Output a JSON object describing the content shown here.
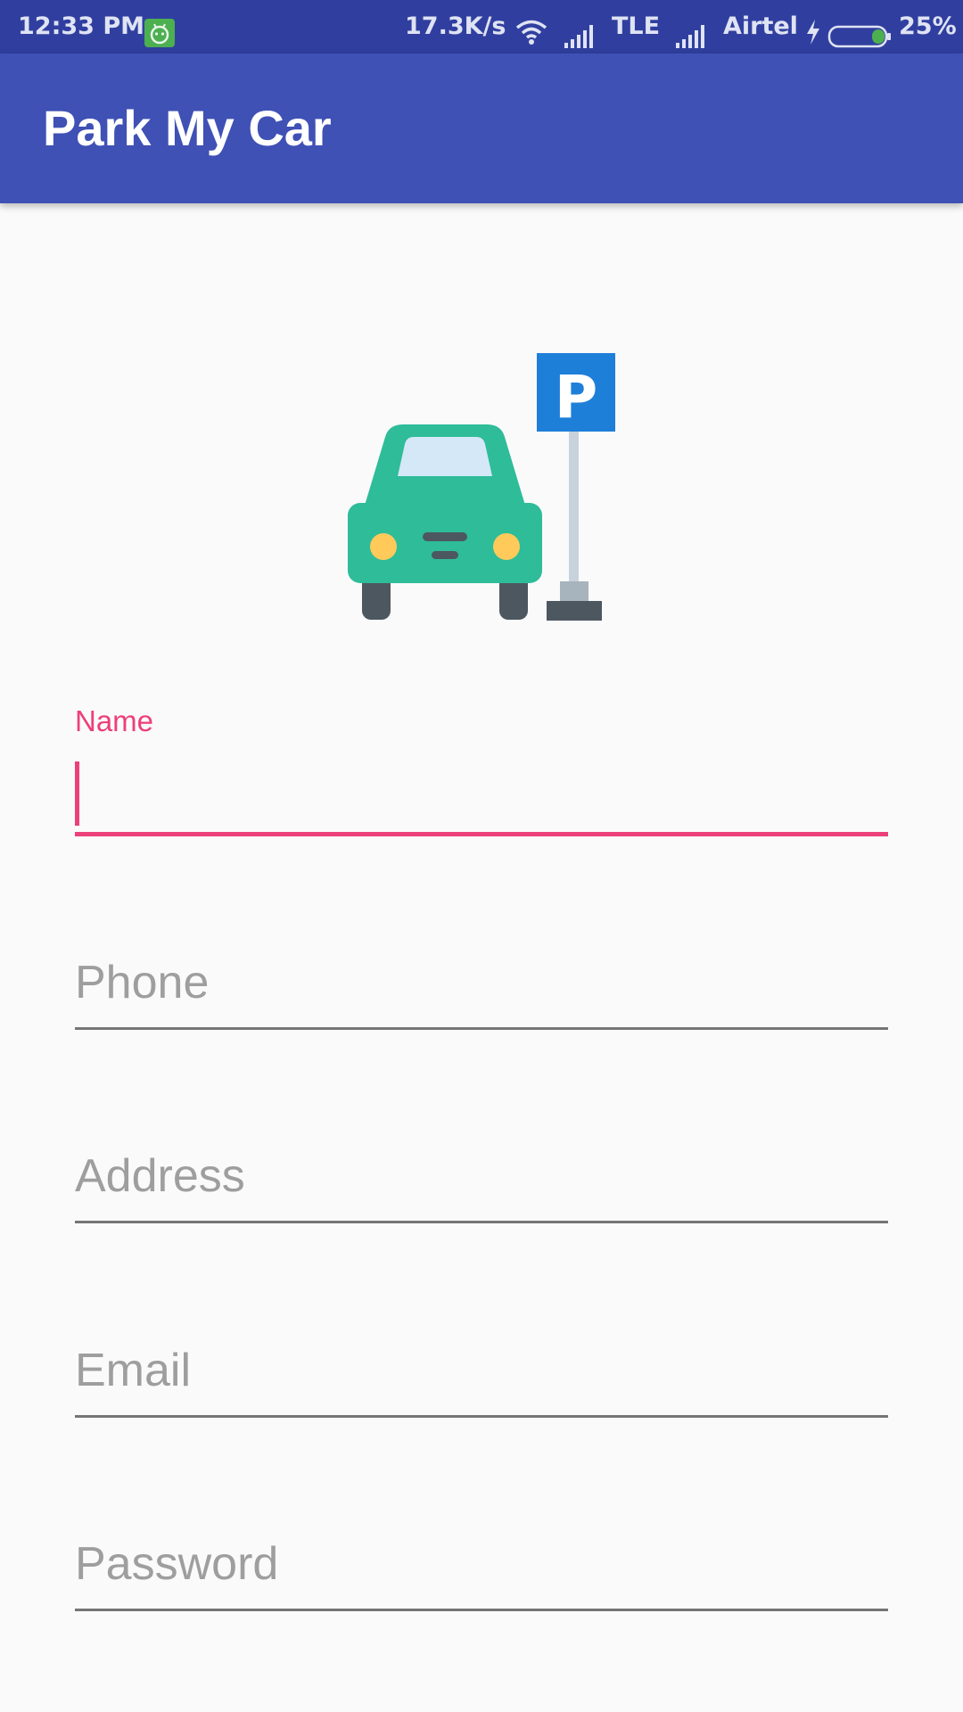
{
  "status_bar": {
    "time": "12:33 PM",
    "speed": "17.3K/s",
    "network_type": "TLE",
    "carrier": "Airtel",
    "battery": "25%",
    "icons": [
      "notification-icon",
      "wifi-icon",
      "signal-icon",
      "charging-icon",
      "battery-icon"
    ]
  },
  "app_bar": {
    "title": "Park My Car"
  },
  "logo": {
    "icon": "car-parking-icon",
    "sign_letter": "P"
  },
  "form": {
    "name": {
      "label": "Name",
      "value": ""
    },
    "phone": {
      "placeholder": "Phone"
    },
    "address": {
      "placeholder": "Address"
    },
    "email": {
      "placeholder": "Email"
    },
    "password": {
      "placeholder": "Password"
    }
  },
  "colors": {
    "status_bar": "#303f9f",
    "app_bar": "#3f51b5",
    "accent": "#ec407a",
    "background": "#fafafa",
    "hint": "#9e9e9e"
  }
}
